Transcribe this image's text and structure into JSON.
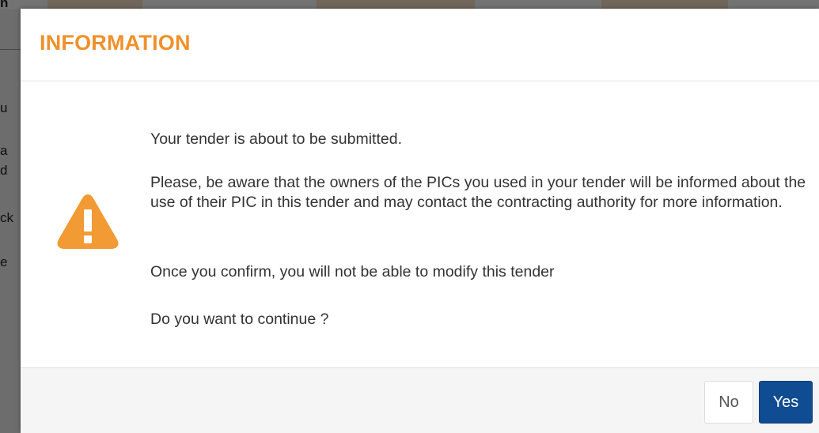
{
  "background": {
    "top_label": "n",
    "fragments": [
      "u",
      "a",
      "d",
      "ck",
      "e"
    ]
  },
  "dialog": {
    "title": "INFORMATION",
    "icon": "warning-triangle-icon",
    "messages": [
      "Your tender is about to be submitted.",
      "Please, be aware that the owners of the PICs you used in your tender will be informed about the use of their PIC in this tender and may contact the contracting authority for more information.",
      "Once you confirm, you will not be able to modify this tender",
      "Do you want to continue ?"
    ],
    "buttons": {
      "no_label": "No",
      "yes_label": "Yes"
    }
  },
  "colors": {
    "title": "#f0902a",
    "warning_icon": "#f29a33",
    "primary_button": "#0f4c92",
    "footer_bg": "#f5f5f5"
  }
}
